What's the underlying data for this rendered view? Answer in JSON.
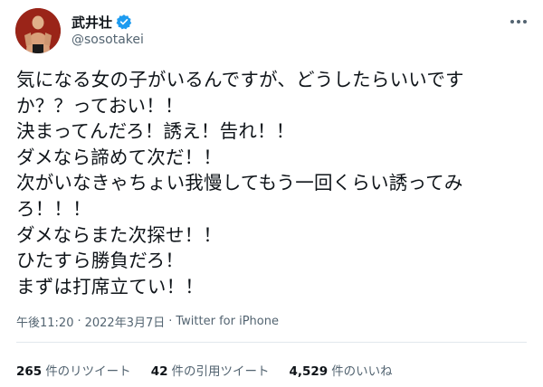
{
  "author": {
    "display_name": "武井壮",
    "handle": "@sosotakei",
    "verified_color": "#1d9bf0"
  },
  "menu_icon": "more-icon",
  "tweet": {
    "lines": [
      "気になる女の子がいるんですが、どうしたらいいです",
      "か？？っておい！！",
      "決まってんだろ！誘え！告れ！！",
      "ダメなら諦めて次だ！！",
      "次がいなきゃちょい我慢してもう一回くらい誘ってみ",
      "ろ！！！",
      "ダメならまた次探せ！！",
      "ひたすら勝負だろ！",
      "まずは打席立てい！！"
    ]
  },
  "meta": {
    "time": "午後11:20",
    "date": "2022年3月7日",
    "source": "Twitter for iPhone",
    "separator": "·"
  },
  "stats": {
    "retweets_count": "265",
    "retweets_label": "件のリツイート",
    "quotes_count": "42",
    "quotes_label": "件の引用ツイート",
    "likes_count": "4,529",
    "likes_label": "件のいいね"
  }
}
